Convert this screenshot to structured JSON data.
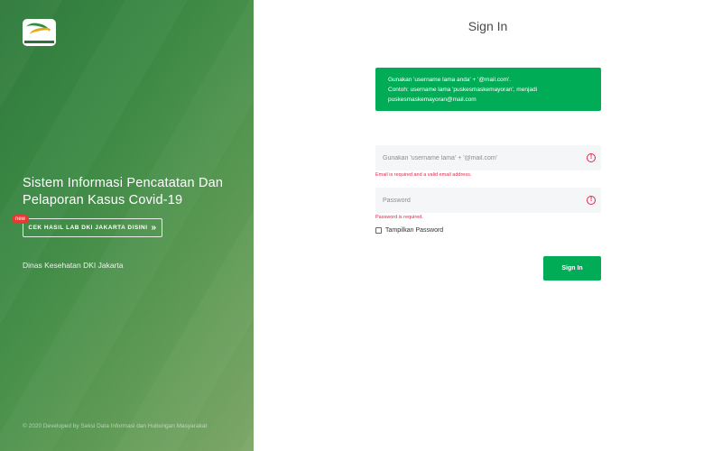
{
  "left_panel": {
    "title": "Sistem Informasi Pencatatan Dan Pelaporan Kasus Covid-19",
    "new_badge": "new",
    "lab_button_label": "CEK HASIL LAB DKI JAKARTA DISINI",
    "lab_button_icon": "chevron-double-right-icon",
    "agency": "Dinas Kesehatan DKI Jakarta",
    "copyright": "© 2020 Developed by Seksi Data Informasi dan Hubungan Masyarakat"
  },
  "form": {
    "title": "Sign In",
    "info_line1": "Gunakan 'username lama anda' + '@mail.com'.",
    "info_line2": "Contoh: username lama 'puskesmaskemayoran', menjadi puskesmaskemayoran@mail.com",
    "email_placeholder": "Gunakan 'username lama' + '@mail.com'",
    "email_error": "Email is required and a valid email address.",
    "password_placeholder": "Password",
    "password_error": "Password is required.",
    "show_password_label": "Tampilkan Password",
    "submit_label": "Sign In"
  },
  "colors": {
    "accent": "#00ad56",
    "error": "#e0284c",
    "panel_green": "#3d8a45"
  }
}
